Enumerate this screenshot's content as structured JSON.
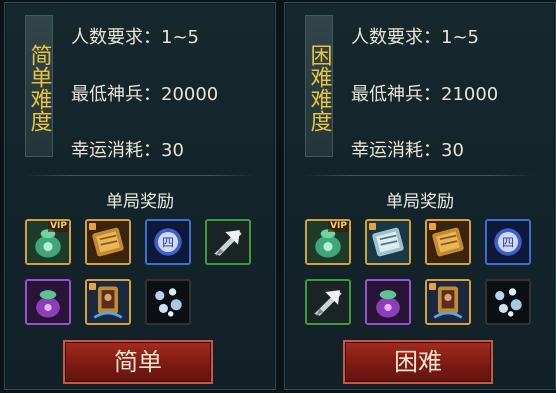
{
  "panels": [
    {
      "label": "简单难度",
      "players_text": "人数要求：1~5",
      "min_weapon_text": "最低神兵：20000",
      "luck_text": "幸运消耗：30",
      "rewards_title": "单局奖励",
      "button_label": "简单",
      "rewards": [
        {
          "icon": "green-bag-icon",
          "vip": "VIP"
        },
        {
          "icon": "golden-scroll-icon",
          "lock": true
        },
        {
          "icon": "blue-orb-icon"
        },
        {
          "icon": "arrow-shard-icon"
        },
        {
          "icon": "purple-gem-bag-icon"
        },
        {
          "icon": "framed-portrait-icon",
          "lock": true
        },
        {
          "icon": "crystal-cluster-icon"
        }
      ]
    },
    {
      "label": "困难难度",
      "players_text": "人数要求：1~5",
      "min_weapon_text": "最低神兵：21000",
      "luck_text": "幸运消耗：30",
      "rewards_title": "单局奖励",
      "button_label": "困难",
      "rewards": [
        {
          "icon": "green-bag-icon",
          "vip": "VIP"
        },
        {
          "icon": "silver-scroll-icon",
          "lock": true
        },
        {
          "icon": "golden-scroll-icon",
          "lock": true
        },
        {
          "icon": "blue-orb-icon"
        },
        {
          "icon": "arrow-shard-icon"
        },
        {
          "icon": "purple-gem-bag-icon"
        },
        {
          "icon": "framed-portrait-icon",
          "lock": true
        },
        {
          "icon": "crystal-cluster-icon"
        }
      ]
    }
  ]
}
